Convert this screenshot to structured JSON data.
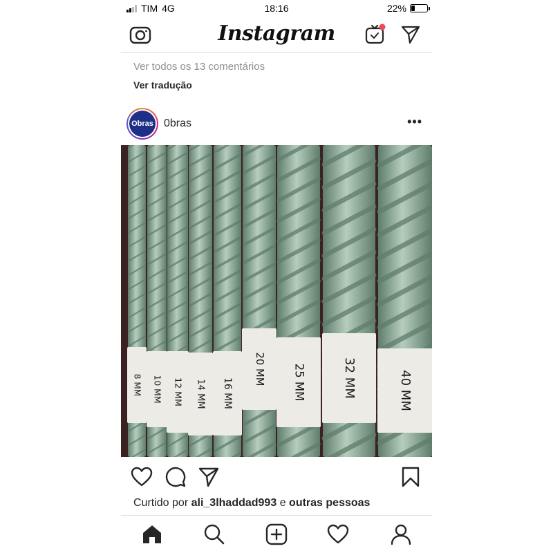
{
  "status_bar": {
    "carrier": "TIM",
    "network": "4G",
    "time": "18:16",
    "battery_percent_label": "22%",
    "battery_level": 0.22
  },
  "header": {
    "logo_text": "Instagram",
    "camera_icon": "camera-icon",
    "igtv_icon": "igtv-icon",
    "direct_icon": "paper-plane-icon"
  },
  "previous_post": {
    "view_comments": "Ver todos os 13 comentários",
    "view_translation": "Ver tradução"
  },
  "post": {
    "avatar_text": "Obras",
    "username": "0bras",
    "more_label": "•••",
    "photo_tags": [
      "8 MM",
      "10 MM",
      "12 MM",
      "14 MM",
      "16 MM",
      "20 MM",
      "25 MM",
      "32 MM",
      "40 MM"
    ],
    "liked_by_prefix": "Curtido por",
    "liked_by_user": "ali_3lhaddad993",
    "liked_by_conjunction": "e",
    "liked_by_others": "outras pessoas"
  },
  "colors": {
    "rebar": "#8fae9a",
    "rebar_shadow": "#5f7d6a",
    "tag": "#ecebe6",
    "background_dark": "#3b2222",
    "avatar_blue": "#1d2f86"
  },
  "bottom_nav": {
    "items": [
      "home-icon",
      "search-icon",
      "new-post-icon",
      "activity-heart-icon",
      "profile-icon"
    ]
  }
}
